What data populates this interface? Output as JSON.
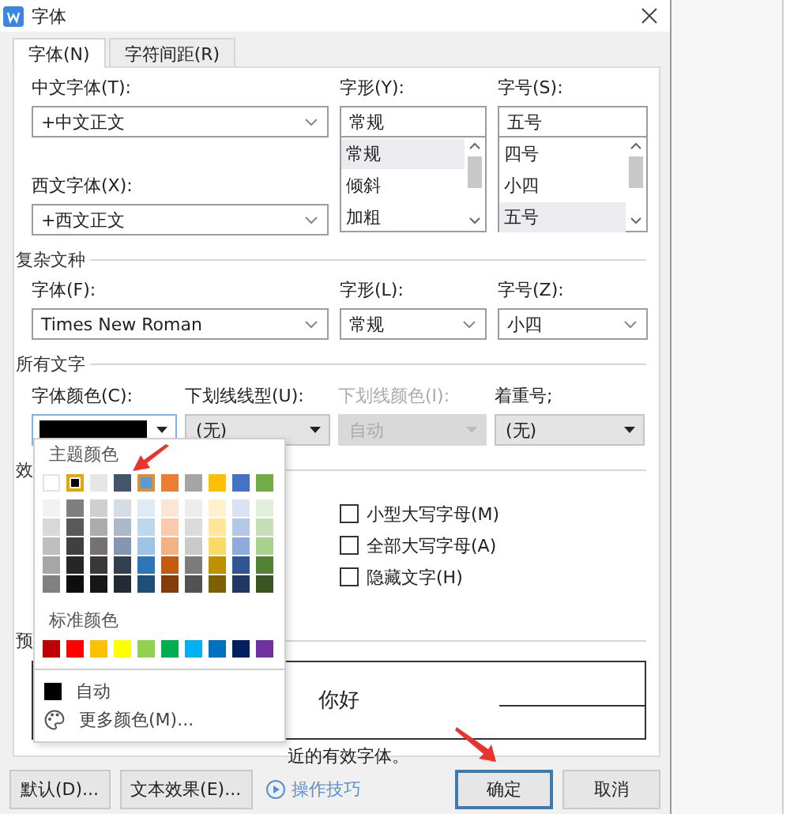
{
  "window": {
    "title": "字体"
  },
  "tabs": [
    {
      "label": "字体(N)",
      "selected": true
    },
    {
      "label": "字符间距(R)",
      "selected": false
    }
  ],
  "chinese_font": {
    "label": "中文字体(T):",
    "value": "+中文正文"
  },
  "western_font": {
    "label": "西文字体(X):",
    "value": "+西文正文"
  },
  "style": {
    "label": "字形(Y):",
    "value": "常规",
    "options": [
      {
        "label": "常规",
        "selected": true
      },
      {
        "label": "倾斜",
        "selected": false
      },
      {
        "label": "加粗",
        "selected": false
      }
    ]
  },
  "size": {
    "label": "字号(S):",
    "value": "五号",
    "options": [
      {
        "label": "四号",
        "selected": false
      },
      {
        "label": "小四",
        "selected": false
      },
      {
        "label": "五号",
        "selected": true
      }
    ]
  },
  "complex_script": {
    "title": "复杂文种",
    "fields": [
      {
        "label": "字体(F):",
        "value": "Times New Roman"
      },
      {
        "label": "字形(L):",
        "value": "常规"
      },
      {
        "label": "字号(Z):",
        "value": "小四"
      }
    ]
  },
  "all_text": {
    "title": "所有文字",
    "font_color": {
      "label": "字体颜色(C):",
      "color": "#000000",
      "expanded": true
    },
    "underline_style": {
      "label": "下划线线型(U):",
      "value": "(无)",
      "disabled": false
    },
    "underline_color": {
      "label": "下划线颜色(I):",
      "value": "自动",
      "disabled": true
    },
    "emphasis": {
      "label": "着重号;",
      "value": "(无)",
      "disabled": false
    }
  },
  "effects": {
    "title": "效",
    "checkboxes": [
      {
        "label": "小型大写字母(M)",
        "checked": false
      },
      {
        "label": "全部大写字母(A)",
        "checked": false
      },
      {
        "label": "隐藏文字(H)",
        "checked": false
      }
    ]
  },
  "preview": {
    "title": "预",
    "sample": "你好",
    "note": "近的有效字体。"
  },
  "buttons": [
    {
      "label": "默认(D)...",
      "kind": "button",
      "default": false
    },
    {
      "label": "文本效果(E)...",
      "kind": "button",
      "default": false
    },
    {
      "label": "操作技巧",
      "kind": "link",
      "default": false
    },
    {
      "label": "确定",
      "kind": "button",
      "default": true
    },
    {
      "label": "取消",
      "kind": "button",
      "default": false
    }
  ],
  "color_popup": {
    "theme_title": "主题颜色",
    "theme_colors": [
      {
        "color": "#ffffff",
        "selected": false,
        "hovered": false
      },
      {
        "color": "#000000",
        "selected": true,
        "hovered": false
      },
      {
        "color": "#e7e6e6",
        "selected": false,
        "hovered": false
      },
      {
        "color": "#44546a",
        "selected": false,
        "hovered": false
      },
      {
        "color": "#5b9bd5",
        "selected": false,
        "hovered": true
      },
      {
        "color": "#ed7d31",
        "selected": false,
        "hovered": false
      },
      {
        "color": "#a5a5a5",
        "selected": false,
        "hovered": false
      },
      {
        "color": "#ffc000",
        "selected": false,
        "hovered": false
      },
      {
        "color": "#4472c4",
        "selected": false,
        "hovered": false
      },
      {
        "color": "#70ad47",
        "selected": false,
        "hovered": false
      }
    ],
    "shades": [
      [
        {
          "color": "#f2f2f2"
        },
        {
          "color": "#7f7f7f"
        },
        {
          "color": "#d0cece"
        },
        {
          "color": "#d6dce4"
        },
        {
          "color": "#deebf6"
        },
        {
          "color": "#fbe5d5"
        },
        {
          "color": "#ededed"
        },
        {
          "color": "#fff2cc"
        },
        {
          "color": "#dae3f3"
        },
        {
          "color": "#e2f0d9"
        }
      ],
      [
        {
          "color": "#d9d9d9"
        },
        {
          "color": "#595959"
        },
        {
          "color": "#aeabab"
        },
        {
          "color": "#adb9ca"
        },
        {
          "color": "#bdd7ee"
        },
        {
          "color": "#f8cbad"
        },
        {
          "color": "#dbdbdb"
        },
        {
          "color": "#ffe699"
        },
        {
          "color": "#b4c7e7"
        },
        {
          "color": "#c5e0b4"
        }
      ],
      [
        {
          "color": "#bfbfbf"
        },
        {
          "color": "#404040"
        },
        {
          "color": "#767171"
        },
        {
          "color": "#8496b0"
        },
        {
          "color": "#9dc3e6"
        },
        {
          "color": "#f4b183"
        },
        {
          "color": "#c9c9c9"
        },
        {
          "color": "#ffd966"
        },
        {
          "color": "#8faadc"
        },
        {
          "color": "#a9d18e"
        }
      ],
      [
        {
          "color": "#a6a6a6"
        },
        {
          "color": "#262626"
        },
        {
          "color": "#3b3838"
        },
        {
          "color": "#323f4f"
        },
        {
          "color": "#2e75b5"
        },
        {
          "color": "#c55a11"
        },
        {
          "color": "#7b7b7b"
        },
        {
          "color": "#bf9000"
        },
        {
          "color": "#2f5597"
        },
        {
          "color": "#538135"
        }
      ],
      [
        {
          "color": "#808080"
        },
        {
          "color": "#0d0d0d"
        },
        {
          "color": "#171616"
        },
        {
          "color": "#222a35"
        },
        {
          "color": "#1f4e79"
        },
        {
          "color": "#843c0b"
        },
        {
          "color": "#525252"
        },
        {
          "color": "#7f6000"
        },
        {
          "color": "#203864"
        },
        {
          "color": "#385723"
        }
      ]
    ],
    "standard_title": "标准颜色",
    "standard_colors": [
      {
        "color": "#c00000"
      },
      {
        "color": "#ff0000"
      },
      {
        "color": "#ffc000"
      },
      {
        "color": "#ffff00"
      },
      {
        "color": "#92d050"
      },
      {
        "color": "#00b050"
      },
      {
        "color": "#00b0f0"
      },
      {
        "color": "#0070c0"
      },
      {
        "color": "#002060"
      },
      {
        "color": "#7030a0"
      }
    ],
    "automatic": {
      "label": "自动",
      "color": "#000000"
    },
    "more_colors": "更多颜色(M)..."
  },
  "annotations": [
    {
      "kind": "arrow"
    },
    {
      "kind": "arrow"
    }
  ]
}
